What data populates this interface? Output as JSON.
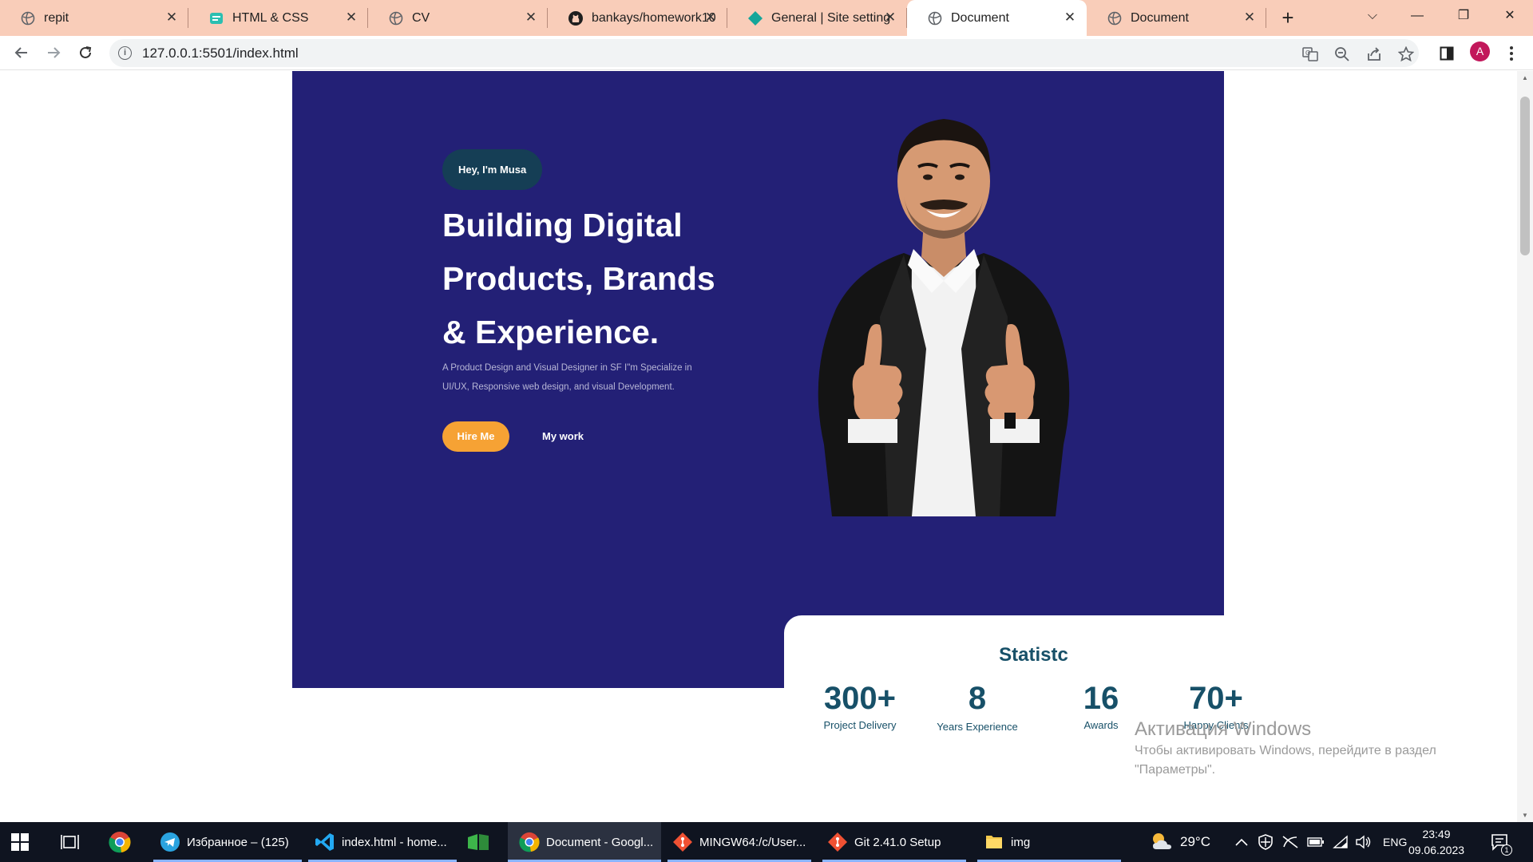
{
  "browser": {
    "tabs": [
      {
        "title": "repit",
        "icon": "globe-icon"
      },
      {
        "title": "HTML & CSS",
        "icon": "html-css-icon"
      },
      {
        "title": "CV",
        "icon": "globe-icon"
      },
      {
        "title": "bankays/homework10",
        "icon": "github-icon"
      },
      {
        "title": "General | Site settings",
        "icon": "netlify-icon"
      },
      {
        "title": "Document",
        "icon": "globe-icon",
        "active": true
      },
      {
        "title": "Document",
        "icon": "globe-icon"
      }
    ],
    "url": "127.0.0.1:5501/index.html",
    "profile_initial": "A",
    "profile_color": "#c2185b"
  },
  "page": {
    "hero": {
      "badge": "Hey, I'm Musa",
      "title_lines": [
        "Building Digital",
        "Products, Brands",
        "& Experience."
      ],
      "subtitle": "A Product Design and Visual Designer in SF I\"m Specialize in UI/UX, Responsive web design, and visual Development.",
      "hire_label": "Hire Me",
      "mywork_label": "My work",
      "background_color": "#232076",
      "accent_color": "#f6a234"
    },
    "stats": {
      "title": "Statistc",
      "items": [
        {
          "value": "300+",
          "label": "Project Delivery"
        },
        {
          "value": "8",
          "label": "Years Experience"
        },
        {
          "value": "16",
          "label": "Awards"
        },
        {
          "value": "70+",
          "label": "Happy Clients"
        }
      ]
    }
  },
  "activation": {
    "title": "Активация Windows",
    "text": "Чтобы активировать Windows, перейдите в раздел \"Параметры\"."
  },
  "taskbar": {
    "items": [
      {
        "label": "Избранное – (125)",
        "icon": "telegram-icon",
        "badge": "125"
      },
      {
        "label": "index.html - home...",
        "icon": "vscode-icon"
      },
      {
        "label": "Document - Googl...",
        "icon": "chrome-icon"
      },
      {
        "label": "MINGW64:/c/User...",
        "icon": "git-bash-icon"
      },
      {
        "label": "Git 2.41.0 Setup",
        "icon": "git-setup-icon"
      },
      {
        "label": "img",
        "icon": "folder-icon"
      }
    ],
    "weather": "29°C",
    "language": "ENG",
    "time": "23:49",
    "date": "09.06.2023",
    "notification_count": "1"
  }
}
